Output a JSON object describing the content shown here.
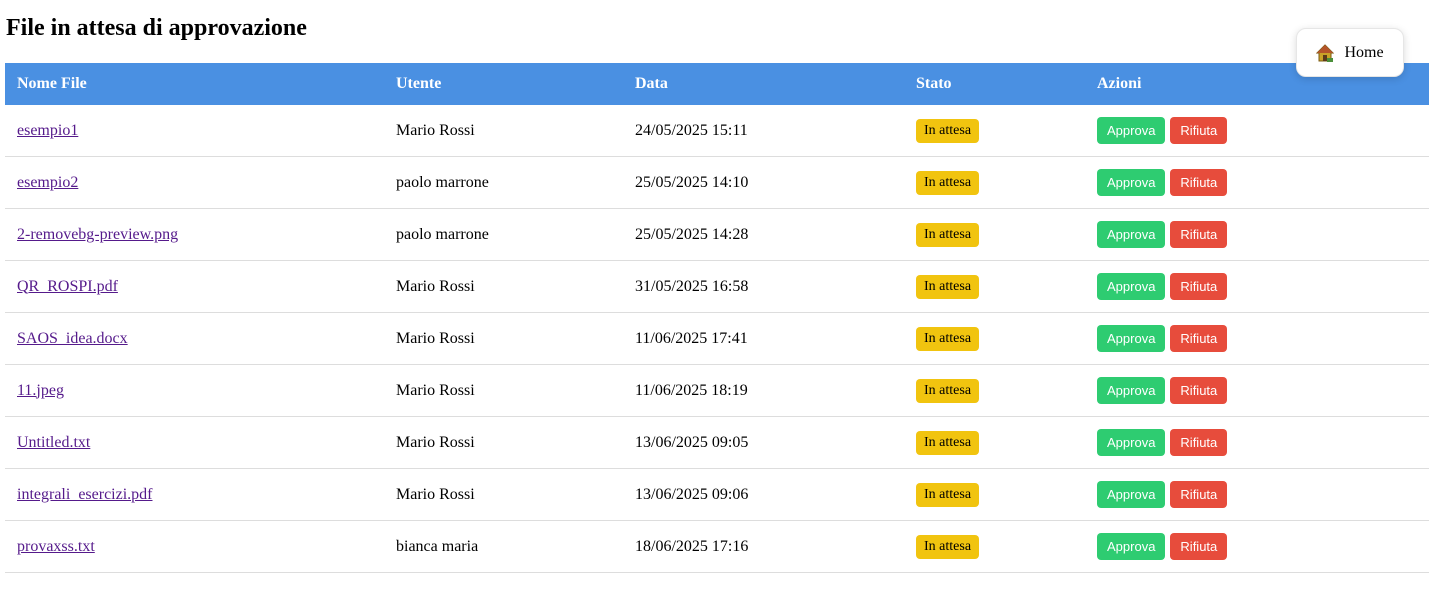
{
  "page": {
    "title": "File in attesa di approvazione"
  },
  "home_button": {
    "label": "Home",
    "icon": "house-icon"
  },
  "table": {
    "headers": [
      "Nome File",
      "Utente",
      "Data",
      "Stato",
      "Azioni"
    ],
    "approve_label": "Approva",
    "reject_label": "Rifiuta",
    "rows": [
      {
        "file": "esempio1",
        "user": "Mario Rossi",
        "date": "24/05/2025 15:11",
        "status": "In attesa"
      },
      {
        "file": "esempio2",
        "user": "paolo marrone",
        "date": "25/05/2025 14:10",
        "status": "In attesa"
      },
      {
        "file": "2-removebg-preview.png",
        "user": "paolo marrone",
        "date": "25/05/2025 14:28",
        "status": "In attesa"
      },
      {
        "file": "QR_ROSPI.pdf",
        "user": "Mario Rossi",
        "date": "31/05/2025 16:58",
        "status": "In attesa"
      },
      {
        "file": "SAOS_idea.docx",
        "user": "Mario Rossi",
        "date": "11/06/2025 17:41",
        "status": "In attesa"
      },
      {
        "file": "11.jpeg",
        "user": "Mario Rossi",
        "date": "11/06/2025 18:19",
        "status": "In attesa"
      },
      {
        "file": "Untitled.txt",
        "user": "Mario Rossi",
        "date": "13/06/2025 09:05",
        "status": "In attesa"
      },
      {
        "file": "integrali_esercizi.pdf",
        "user": "Mario Rossi",
        "date": "13/06/2025 09:06",
        "status": "In attesa"
      },
      {
        "file": "provaxss.txt",
        "user": "bianca maria",
        "date": "18/06/2025 17:16",
        "status": "In attesa"
      }
    ]
  },
  "colors": {
    "header_bg": "#4a90e2",
    "badge_bg": "#f1c40f",
    "approve_bg": "#2ecc71",
    "reject_bg": "#e74c3c",
    "link": "#551a8b"
  }
}
